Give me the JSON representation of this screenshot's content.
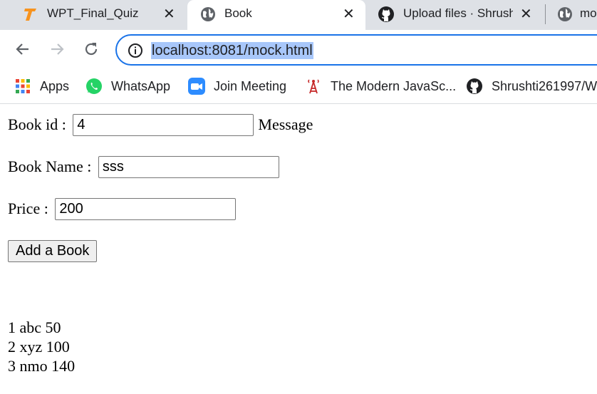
{
  "browser": {
    "tabs": [
      {
        "title": "WPT_Final_Quiz",
        "icon": "testbook-icon",
        "active": false
      },
      {
        "title": "Book",
        "icon": "globe-icon",
        "active": true
      },
      {
        "title": "Upload files · Shrushti",
        "icon": "github-icon",
        "active": false
      },
      {
        "title": "mo",
        "icon": "globe-icon",
        "active": false
      }
    ],
    "close_glyph": "✕",
    "url": "localhost:8081/mock.html",
    "bookmarks": [
      {
        "label": "Apps",
        "icon": "apps-grid-icon"
      },
      {
        "label": "WhatsApp",
        "icon": "whatsapp-icon"
      },
      {
        "label": "Join Meeting",
        "icon": "zoom-icon"
      },
      {
        "label": "The Modern JavaSc...",
        "icon": "tower-icon"
      },
      {
        "label": "Shrushti261997/W",
        "icon": "github-icon"
      }
    ]
  },
  "form": {
    "book_id_label": "Book id : ",
    "book_id_value": "4",
    "message_label": "Message",
    "book_name_label": "Book Name : ",
    "book_name_value": "sss",
    "price_label": "Price : ",
    "price_value": "200",
    "submit_label": "Add a Book"
  },
  "books": [
    "1 abc 50",
    "2 xyz 100",
    "3 nmo 140"
  ],
  "colors": {
    "tabstrip": "#dee1e6",
    "omnibox_border": "#1a73e8",
    "url_highlight": "#a8c7fa"
  }
}
